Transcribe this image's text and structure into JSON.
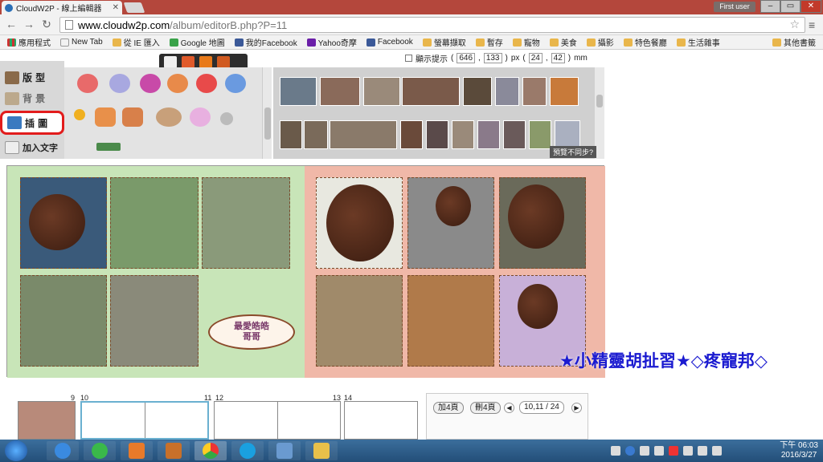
{
  "browser": {
    "tab_title": "CloudW2P - 線上編輯器",
    "user": "First user",
    "url_host": "www.cloudw2p.com",
    "url_path": "/album/editorB.php?P=11"
  },
  "bookmarks": [
    {
      "label": "應用程式",
      "icon": "apps-grid-icon"
    },
    {
      "label": "New Tab",
      "icon": "page-icon"
    },
    {
      "label": "從 IE 匯入",
      "icon": "folder-icon"
    },
    {
      "label": "Google 地圖",
      "icon": "google-maps-icon"
    },
    {
      "label": "我的Facebook",
      "icon": "facebook-icon"
    },
    {
      "label": "Yahoo奇摩",
      "icon": "yahoo-icon"
    },
    {
      "label": "Facebook",
      "icon": "facebook-icon"
    },
    {
      "label": "螢幕擷取",
      "icon": "folder-icon"
    },
    {
      "label": "暫存",
      "icon": "folder-icon"
    },
    {
      "label": "寵物",
      "icon": "folder-icon"
    },
    {
      "label": "美食",
      "icon": "folder-icon"
    },
    {
      "label": "攝影",
      "icon": "folder-icon"
    },
    {
      "label": "特色餐廳",
      "icon": "folder-icon"
    },
    {
      "label": "生活雜事",
      "icon": "folder-icon"
    }
  ],
  "bookmarks_other": "其他書籤",
  "editor": {
    "hint_label": "顯示提示",
    "coord_x": "646",
    "coord_y": "133",
    "unit1": "px",
    "size_w": "24",
    "size_h": "42",
    "unit2": "mm",
    "left_menu": [
      "版 型",
      "背 景",
      "插 圖",
      "加入文字"
    ],
    "sync_note": "預覽不同步?",
    "album_label": "最愛皓皓\n哥哥",
    "watermark": "★小精靈胡扯習★◇疼寵邦◇"
  },
  "pages": {
    "nums": [
      "9",
      "10",
      "11",
      "12",
      "13",
      "14"
    ],
    "add_btn": "加4頁",
    "del_btn": "刪4頁",
    "current": "10,11 / 24"
  },
  "taskbar": {
    "time": "下午 06:03",
    "date": "2016/3/27"
  }
}
